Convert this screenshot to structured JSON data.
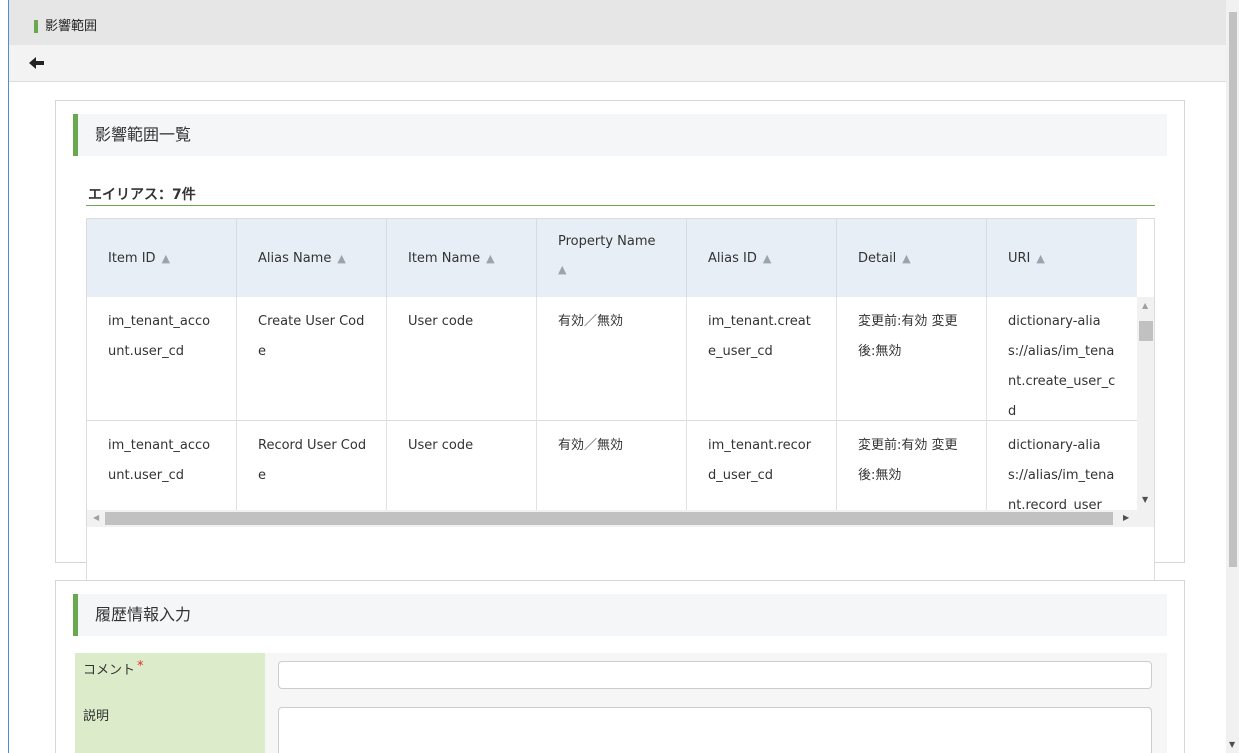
{
  "title_bar": {
    "title": "影響範囲"
  },
  "toolbar": {
    "back_icon": "arrow-left-icon"
  },
  "impact_section": {
    "heading": "影響範囲一覧",
    "count_label": "エイリアス：7件",
    "columns": [
      {
        "label": "Item ID"
      },
      {
        "label": "Alias Name"
      },
      {
        "label": "Item Name"
      },
      {
        "label": "Property Name"
      },
      {
        "label": "Alias ID"
      },
      {
        "label": "Detail"
      },
      {
        "label": "URI"
      }
    ],
    "sort_icon": "sort-icon",
    "rows": [
      {
        "item_id": "im_tenant_account.user_cd",
        "alias_name": "Create User Code",
        "item_name": "User code",
        "property_name": "有効／無効",
        "alias_id": "im_tenant.create_user_cd",
        "detail": "変更前:有効 変更後:無効",
        "uri": "dictionary-alias://alias/im_tenant.create_user_cd"
      },
      {
        "item_id": "im_tenant_account.user_cd",
        "alias_name": "Record User Code",
        "item_name": "User code",
        "property_name": "有効／無効",
        "alias_id": "im_tenant.record_user_cd",
        "detail": "変更前:有効 変更後:無効",
        "uri": "dictionary-alias://alias/im_tenant.record_user"
      }
    ]
  },
  "history_section": {
    "heading": "履歴情報入力",
    "comment_label": "コメント",
    "comment_required_mark": "*",
    "comment_value": "",
    "description_label": "説明",
    "description_value": ""
  },
  "colors": {
    "accent_green": "#6aa84f",
    "form_label_bg": "#dcebc9",
    "required_red": "#e03030",
    "table_header_bg": "#e8eef5"
  }
}
